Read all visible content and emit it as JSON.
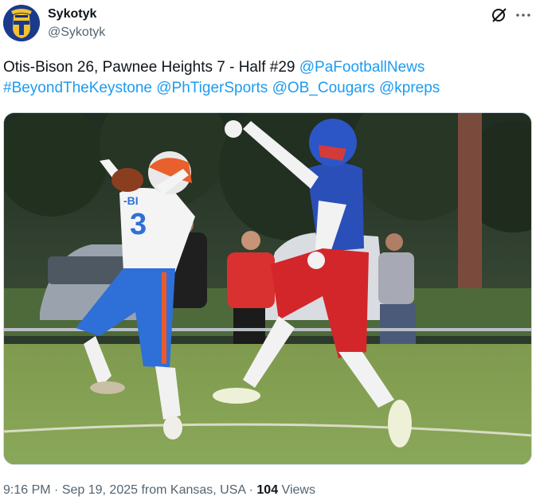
{
  "author": {
    "display_name": "Sykotyk",
    "handle": "@Sykotyk",
    "avatar_icon": "spartan-helmet-icon"
  },
  "actions": {
    "grok_icon": "grok-icon",
    "more_icon": "more-icon"
  },
  "tweet": {
    "line1_text": "Otis-Bison 26, Pawnee Heights 7 - Half #29 ",
    "mentions": {
      "pafootballnews": "@PaFootballNews",
      "beyondthekeystone": "#BeyondTheKeystone",
      "phtigersports": "@PhTigerSports",
      "ob_cougars": "@OB_Cougars",
      "kpreps": "@kpreps"
    }
  },
  "media": {
    "player_left_jersey_number": "3",
    "player_left_jersey_text": "-BI"
  },
  "meta": {
    "time": "9:16 PM",
    "separator": " · ",
    "date": "Sep 19, 2025",
    "location": " from Kansas, USA",
    "views_count": "104",
    "views_label": " Views"
  },
  "colors": {
    "link": "#1d9bf0",
    "secondary_text": "#536471",
    "primary_text": "#0f1419"
  }
}
